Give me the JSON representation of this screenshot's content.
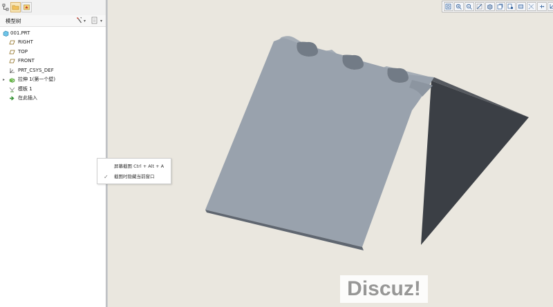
{
  "model_tree": {
    "title": "模型树",
    "items": [
      {
        "label": "001.PRT",
        "icon": "part-icon"
      },
      {
        "label": "RIGHT",
        "icon": "datum-plane-icon"
      },
      {
        "label": "TOP",
        "icon": "datum-plane-icon"
      },
      {
        "label": "FRONT",
        "icon": "datum-plane-icon"
      },
      {
        "label": "PRT_CSYS_DEF",
        "icon": "csys-icon"
      },
      {
        "label": "拉伸 1(第一个壁)",
        "icon": "extrude-icon",
        "expandable": true
      },
      {
        "label": "模板 1",
        "icon": "template-icon"
      },
      {
        "label": "在此插入",
        "icon": "insert-here-icon"
      }
    ]
  },
  "context_menu": {
    "items": [
      {
        "label": "屏幕截图 Ctrl + Alt + A",
        "checked": false
      },
      {
        "label": "截图时隐藏当前窗口",
        "checked": true
      }
    ]
  },
  "view_toolbar": {
    "buttons": [
      "refit-icon",
      "zoom-in-icon",
      "zoom-out-icon",
      "repaint-icon",
      "shading-icon",
      "saved-views-icon",
      "view-manager-icon",
      "datum-planes-icon",
      "datum-axes-icon",
      "datum-points-icon",
      "csys-display-icon",
      "annotation-icon"
    ]
  },
  "watermark": {
    "text": "Discuz!"
  },
  "colors": {
    "viewport_bg": "#eae7df",
    "model_face": "#9ba4af",
    "model_dark_face": "#3b3f45",
    "accent": "#2f5f9a"
  }
}
